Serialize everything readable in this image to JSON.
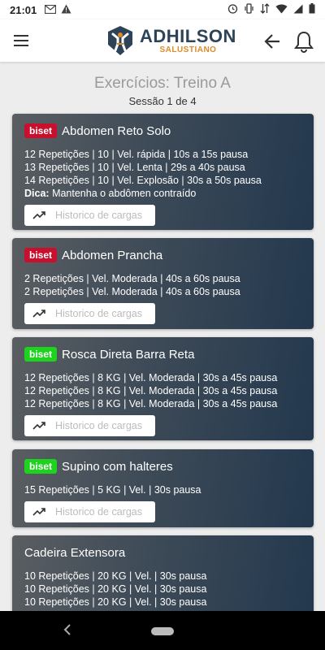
{
  "status": {
    "time": "21:01"
  },
  "header": {
    "brand_name": "ADHILSON",
    "brand_sub": "SALUSTIANO"
  },
  "page": {
    "title": "Exercícios: Treino A",
    "subtitle": "Sessão 1 de 4"
  },
  "history_label": "Historico de cargas",
  "tip_label": "Dica:",
  "colors": {
    "badge_red": "#c8102e",
    "badge_green": "#1ed31e",
    "brand": "#2d4358",
    "accent": "#e08a2a"
  },
  "exercises": [
    {
      "badge": "biset",
      "badge_color": "red",
      "name": "Abdomen Reto Solo",
      "lines": [
        "12 Repetições | 10 | Vel. rápida | 10s a 15s pausa",
        "13 Repetições | 10 | Vel. Lenta | 29s a 40s pausa",
        "14 Repetições | 10 | Vel. Explosão | 30s a 50s pausa"
      ],
      "tip": "Mantenha o abdômen contraído"
    },
    {
      "badge": "biset",
      "badge_color": "red",
      "name": "Abdomen Prancha",
      "lines": [
        "2 Repetições | Vel. Moderada | 40s a 60s pausa",
        "2 Repetições | Vel. Moderada | 40s a 60s pausa"
      ]
    },
    {
      "badge": "biset",
      "badge_color": "green",
      "name": "Rosca Direta Barra Reta",
      "lines": [
        "12 Repetições | 8 KG | Vel. Moderada | 30s a 45s pausa",
        "12 Repetições | 8 KG | Vel. Moderada | 30s a 45s pausa",
        "12 Repetições | 8 KG | Vel. Moderada | 30s a 45s pausa"
      ]
    },
    {
      "badge": "biset",
      "badge_color": "green",
      "name": "Supino com halteres",
      "lines": [
        "15 Repetições | 5 KG | Vel. | 30s pausa"
      ]
    },
    {
      "name": "Cadeira Extensora",
      "lines": [
        "10 Repetições | 20 KG | Vel. | 30s pausa",
        "10 Repetições | 20 KG | Vel. | 30s pausa",
        "10 Repetições | 20 KG | Vel. | 30s pausa"
      ]
    }
  ]
}
